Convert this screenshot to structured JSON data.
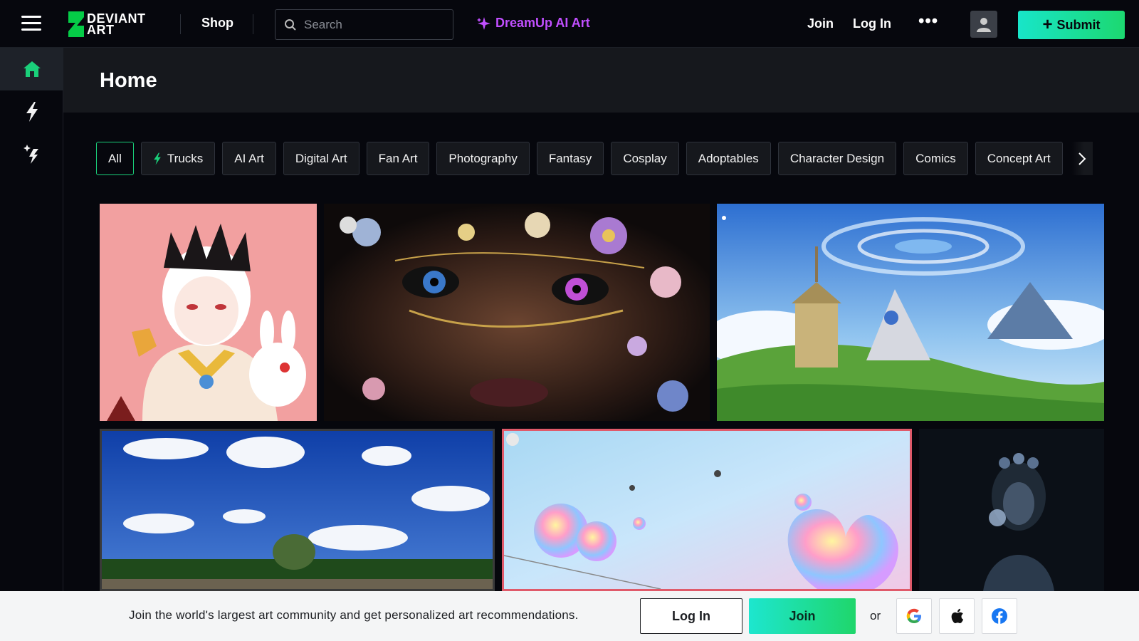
{
  "topbar": {
    "logo_line1": "DEVIANT",
    "logo_line2": "ART",
    "shop_label": "Shop",
    "search_placeholder": "Search",
    "dreamup_label": "DreamUp AI Art",
    "join_label": "Join",
    "login_label": "Log In",
    "more_label": "•••",
    "submit_label": "Submit"
  },
  "leftrail": {
    "items": [
      {
        "icon": "home-icon",
        "active": true
      },
      {
        "icon": "lightning-icon",
        "active": false
      },
      {
        "icon": "dreamup-sparkle-icon",
        "active": false
      }
    ]
  },
  "page": {
    "title": "Home"
  },
  "chips": [
    {
      "label": "All",
      "active": true
    },
    {
      "label": "Trucks",
      "icon": "lightning-icon"
    },
    {
      "label": "AI Art"
    },
    {
      "label": "Digital Art"
    },
    {
      "label": "Fan Art"
    },
    {
      "label": "Photography"
    },
    {
      "label": "Fantasy"
    },
    {
      "label": "Cosplay"
    },
    {
      "label": "Adoptables"
    },
    {
      "label": "Character Design"
    },
    {
      "label": "Comics"
    },
    {
      "label": "Concept Art"
    }
  ],
  "gallery": {
    "tiles": [
      {
        "subject": "anime boy with crown and bunny on pink background"
      },
      {
        "subject": "floral masked face with purple eyes"
      },
      {
        "subject": "fantasy landscape with tower and sky vortex"
      },
      {
        "subject": "blue sky with clouds over tree line"
      },
      {
        "subject": "iridescent bubbles on pastel background"
      },
      {
        "subject": "dark portrait of woman with flower crown"
      }
    ]
  },
  "banner": {
    "text": "Join the world's largest art community and get personalized art recommendations.",
    "login_label": "Log In",
    "join_label": "Join",
    "or_label": "or",
    "social": [
      "google-icon",
      "apple-icon",
      "facebook-icon"
    ]
  },
  "colors": {
    "accent_green": "#1ad07a",
    "dreamup_purple": "#c14fff",
    "background": "#06070d"
  }
}
